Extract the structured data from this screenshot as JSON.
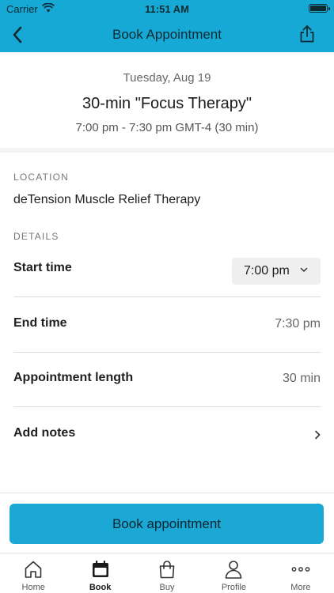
{
  "status_bar": {
    "carrier": "Carrier",
    "time": "11:51 AM"
  },
  "nav": {
    "title": "Book Appointment",
    "back_icon": "chevron-left-icon",
    "share_icon": "share-icon"
  },
  "summary": {
    "date": "Tuesday, Aug 19",
    "title": "30-min \"Focus Therapy\"",
    "time_range": "7:00 pm - 7:30 pm GMT-4 (30 min)"
  },
  "location": {
    "label": "LOCATION",
    "name": "deTension Muscle Relief Therapy"
  },
  "details": {
    "label": "DETAILS",
    "start_time_label": "Start time",
    "start_time_value": "7:00 pm",
    "end_time_label": "End time",
    "end_time_value": "7:30 pm",
    "length_label": "Appointment length",
    "length_value": "30 min",
    "notes_label": "Add notes"
  },
  "book_button": "Book appointment",
  "tabs": [
    {
      "label": "Home",
      "icon": "home-icon",
      "active": false
    },
    {
      "label": "Book",
      "icon": "calendar-icon",
      "active": true
    },
    {
      "label": "Buy",
      "icon": "shopping-bag-icon",
      "active": false
    },
    {
      "label": "Profile",
      "icon": "person-icon",
      "active": false
    },
    {
      "label": "More",
      "icon": "more-dots-icon",
      "active": false
    }
  ],
  "colors": {
    "brand": "#16a9d6",
    "button": "#1ba8d4"
  }
}
